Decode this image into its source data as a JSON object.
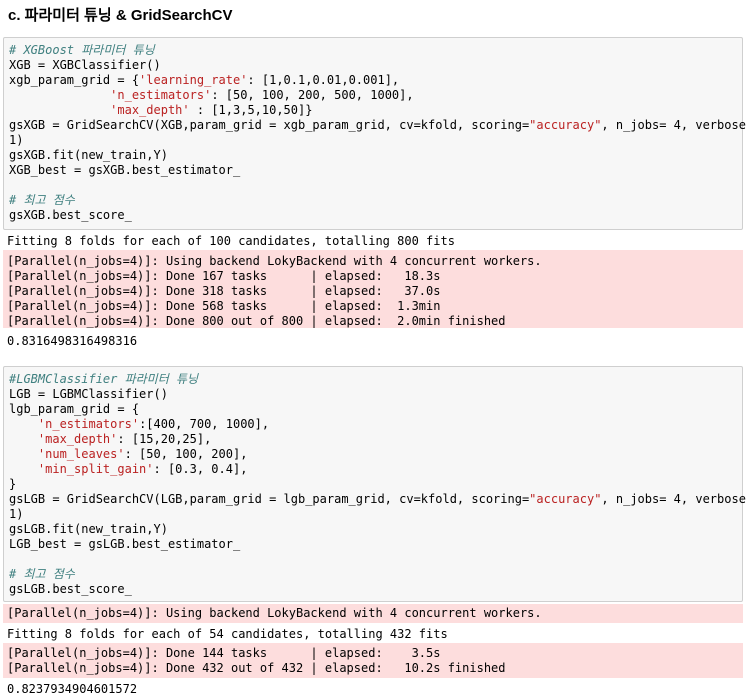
{
  "heading": "c. 파라미터 튜닝 & GridSearchCV",
  "cell1": {
    "comment1": "# XGBoost 파라미터 튜닝",
    "l1": "XGB = XGBClassifier()",
    "l2a": "xgb_param_grid = {",
    "l2s": "'learning_rate'",
    "l2b": ": [1,0.1,0.01,0.001],",
    "l3a": "              ",
    "l3s": "'n_estimators'",
    "l3b": ": [50, 100, 200, 500, 1000],",
    "l4a": "              ",
    "l4s": "'max_depth'",
    "l4b": " : [1,3,5,10,50]}",
    "l5a": "gsXGB = GridSearchCV(XGB,param_grid = xgb_param_grid, cv=kfold, scoring=",
    "l5s": "\"accuracy\"",
    "l5b": ", n_jobs= 4, verbose =",
    "l6": "1)",
    "l7": "gsXGB.fit(new_train,Y)",
    "l8": "XGB_best = gsXGB.best_estimator_",
    "comment2": "# 최고 점수",
    "l9": "gsXGB.best_score_"
  },
  "output1": {
    "fitting": "Fitting 8 folds for each of 100 candidates, totalling 800 fits",
    "parallel": [
      "[Parallel(n_jobs=4)]: Using backend LokyBackend with 4 concurrent workers.",
      "[Parallel(n_jobs=4)]: Done 167 tasks      | elapsed:   18.3s",
      "[Parallel(n_jobs=4)]: Done 318 tasks      | elapsed:   37.0s",
      "[Parallel(n_jobs=4)]: Done 568 tasks      | elapsed:  1.3min",
      "[Parallel(n_jobs=4)]: Done 800 out of 800 | elapsed:  2.0min finished"
    ],
    "result": "0.8316498316498316"
  },
  "cell2": {
    "comment1": "#LGBMClassifier 파라미터 튜닝",
    "l1": "LGB = LGBMClassifier()",
    "l2": "lgb_param_grid = {",
    "l3a": "    ",
    "l3s": "'n_estimators'",
    "l3b": ":[400, 700, 1000],",
    "l4a": "    ",
    "l4s": "'max_depth'",
    "l4b": ": [15,20,25],",
    "l5a": "    ",
    "l5s": "'num_leaves'",
    "l5b": ": [50, 100, 200],",
    "l6a": "    ",
    "l6s": "'min_split_gain'",
    "l6b": ": [0.3, 0.4],",
    "l7": "}",
    "l8a": "gsLGB = GridSearchCV(LGB,param_grid = lgb_param_grid, cv=kfold, scoring=",
    "l8s": "\"accuracy\"",
    "l8b": ", n_jobs= 4, verbose =",
    "l9": "1)",
    "l10": "gsLGB.fit(new_train,Y)",
    "l11": "LGB_best = gsLGB.best_estimator_",
    "comment2": "# 최고 점수",
    "l12": "gsLGB.best_score_"
  },
  "output2": {
    "parallel_start": "[Parallel(n_jobs=4)]: Using backend LokyBackend with 4 concurrent workers.",
    "fitting": "Fitting 8 folds for each of 54 candidates, totalling 432 fits",
    "parallel": [
      "[Parallel(n_jobs=4)]: Done 144 tasks      | elapsed:    3.5s",
      "[Parallel(n_jobs=4)]: Done 432 out of 432 | elapsed:   10.2s finished"
    ],
    "result": "0.8237934904601572"
  }
}
